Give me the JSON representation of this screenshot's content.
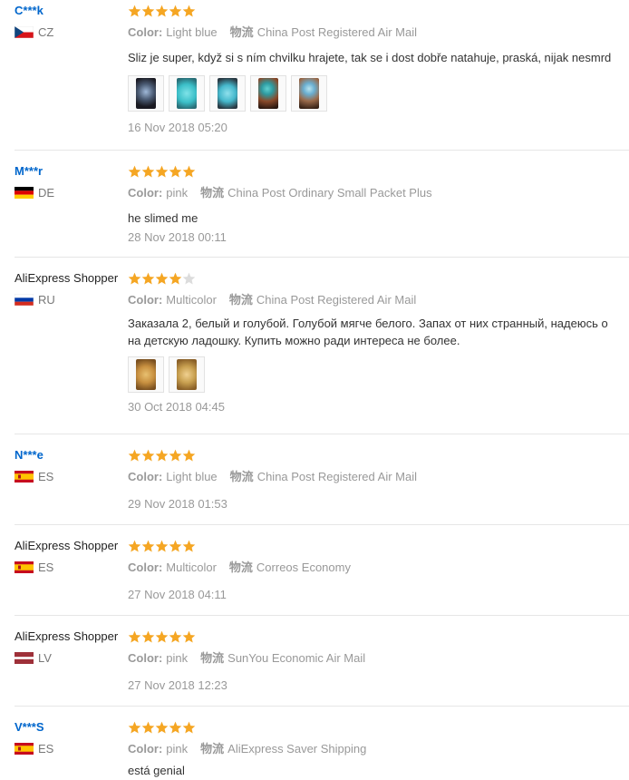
{
  "labels": {
    "color": "Color:",
    "shipping": "物流"
  },
  "colors": {
    "star_on": "#f5a623",
    "star_off": "#dcdcdc",
    "name_link": "#0066cc"
  },
  "reviews": [
    {
      "user": "C***k",
      "country": "CZ",
      "flag": "cz",
      "stars": 5,
      "color": "Light blue",
      "shipping": "China Post Registered Air Mail",
      "text": "Sliz je super, když si s ním chvilku hrajete, tak se i dost dobře natahuje, praská, nijak nesmrd",
      "photos": [
        "dark-slime-photo",
        "turquoise-slime-photo",
        "blue-slime-photo",
        "slime-in-hand-photo",
        "slime-in-hand-photo"
      ],
      "date": "16 Nov 2018 05:20"
    },
    {
      "user": "M***r",
      "country": "DE",
      "flag": "de",
      "stars": 5,
      "color": "pink",
      "shipping": "China Post Ordinary Small Packet Plus",
      "text": "he slimed me",
      "photos": [],
      "date": "28 Nov 2018 00:11"
    },
    {
      "user": "AliExpress Shopper",
      "country": "RU",
      "flag": "ru",
      "stars": 4,
      "color": "Multicolor",
      "shipping": "China Post Registered Air Mail",
      "text": "Заказала 2, белый и голубой. Голубой мягче белого. Запах от них странный, надеюсь о",
      "text2": "на детскую ладошку. Купить можно ради интереса не более.",
      "photos": [
        "gold-slime-photo",
        "gold-slime-photo"
      ],
      "date": "30 Oct 2018 04:45"
    },
    {
      "user": "N***e",
      "country": "ES",
      "flag": "es",
      "stars": 5,
      "color": "Light blue",
      "shipping": "China Post Registered Air Mail",
      "text": "",
      "photos": [],
      "date": "29 Nov 2018 01:53"
    },
    {
      "user": "AliExpress Shopper",
      "country": "ES",
      "flag": "es",
      "stars": 5,
      "color": "Multicolor",
      "shipping": "Correos Economy",
      "text": "",
      "photos": [],
      "date": "27 Nov 2018 04:11"
    },
    {
      "user": "AliExpress Shopper",
      "country": "LV",
      "flag": "lv",
      "stars": 5,
      "color": "pink",
      "shipping": "SunYou Economic Air Mail",
      "text": "",
      "photos": [],
      "date": "27 Nov 2018 12:23"
    },
    {
      "user": "V***S",
      "country": "ES",
      "flag": "es",
      "stars": 5,
      "color": "pink",
      "shipping": "AliExpress Saver Shipping",
      "text": "está genial",
      "photos": [],
      "date": ""
    }
  ]
}
